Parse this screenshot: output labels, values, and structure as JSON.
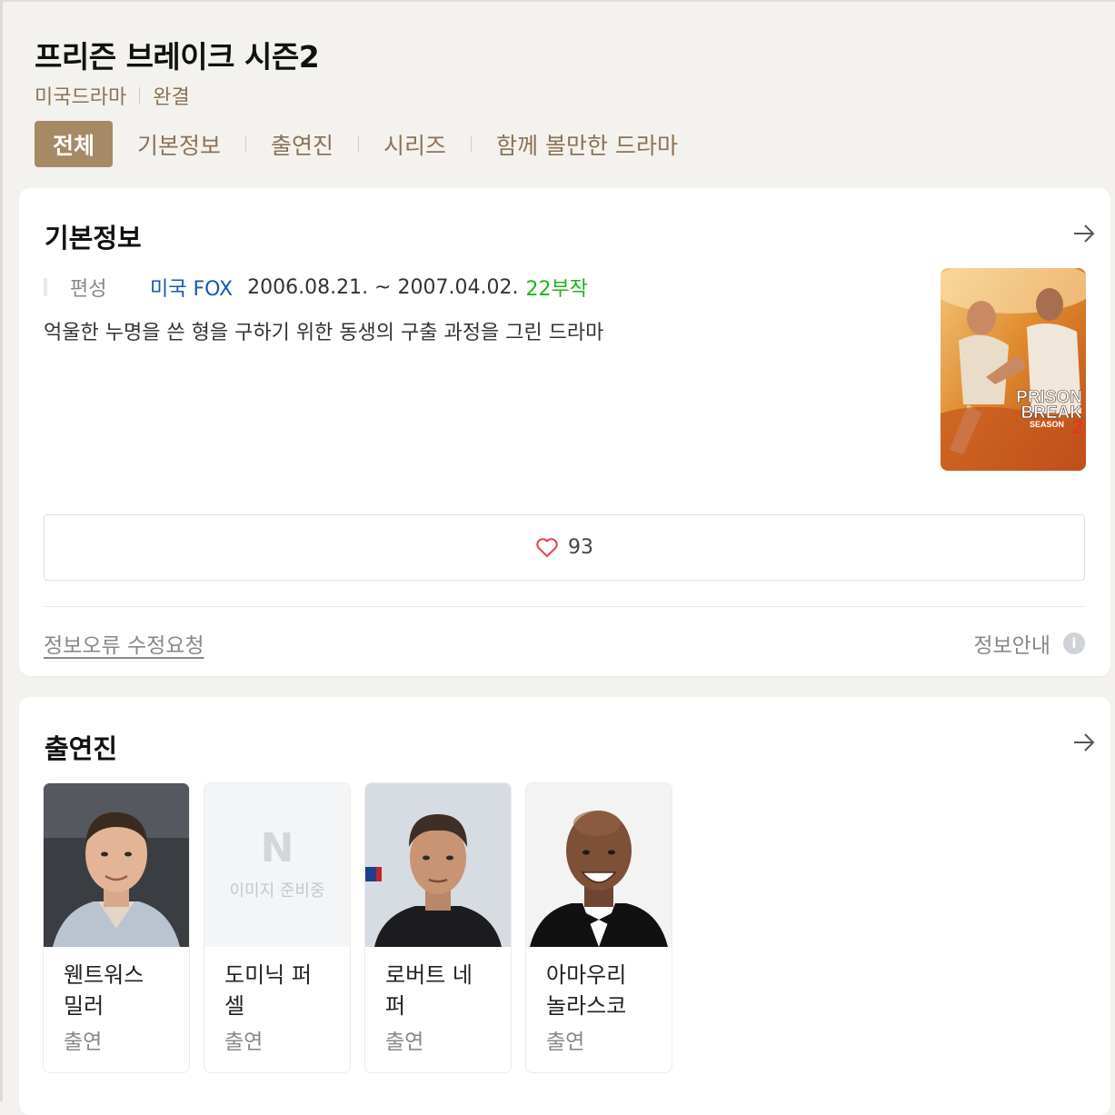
{
  "header": {
    "title": "프리즌 브레이크 시즌2",
    "genre": "미국드라마",
    "status": "완결"
  },
  "tabs": [
    {
      "label": "전체",
      "active": true
    },
    {
      "label": "기본정보"
    },
    {
      "label": "출연진"
    },
    {
      "label": "시리즈"
    },
    {
      "label": "함께 볼만한 드라마"
    }
  ],
  "basic_info": {
    "heading": "기본정보",
    "arrow_icon": "arrow-right-icon",
    "label": "편성",
    "network": "미국 FOX",
    "dates": "2006.08.21. ~ 2007.04.02.",
    "episodes": "22부작",
    "description": "억울한 누명을 쓴 형을 구하기 위한 동생의 구출 과정을 그린 드라마",
    "poster_text": {
      "line1": "PRISON",
      "line2": "BREAK",
      "line3": "SEASON",
      "season": "2"
    },
    "likes": "93",
    "report_link": "정보오류 수정요청",
    "info_guide": "정보안내",
    "info_icon": "i"
  },
  "cast_section": {
    "heading": "출연진",
    "placeholder_logo": "N",
    "placeholder_text": "이미지 준비중",
    "members": [
      {
        "name": "웬트워스 밀러",
        "role": "출연"
      },
      {
        "name": "도미닉 퍼셀",
        "role": "출연"
      },
      {
        "name": "로버트 네퍼",
        "role": "출연"
      },
      {
        "name": "아마우리 놀라스코",
        "role": "출연"
      }
    ]
  },
  "colors": {
    "accent": "#a68a66",
    "tab_text": "#8b7355",
    "network_link": "#1a55b4",
    "episodes": "#1bb41b",
    "heart": "#e2404f"
  }
}
